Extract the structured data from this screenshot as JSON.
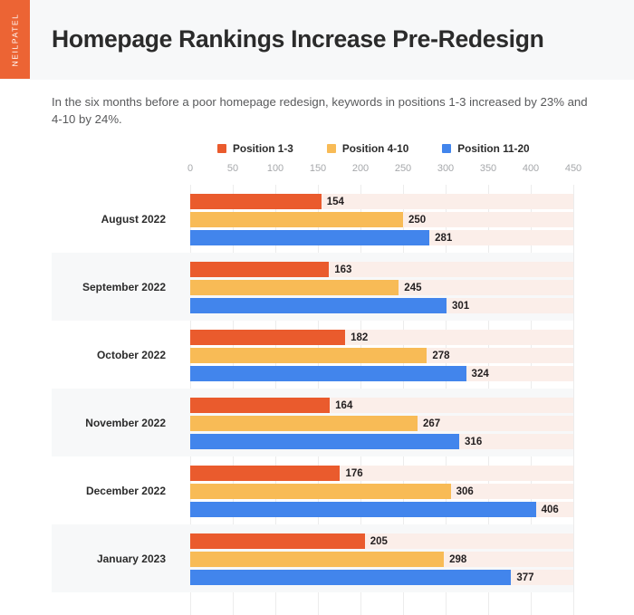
{
  "brand": {
    "name": "NEILPATEL"
  },
  "header": {
    "title": "Homepage Rankings Increase Pre-Redesign"
  },
  "subtitle": {
    "text": "In the six months before a poor homepage redesign, keywords in positions 1-3 increased by 23% and 4-10 by 24%."
  },
  "colors": {
    "position_1_3": "#ea5b2d",
    "position_4_10": "#f8bb56",
    "position_11_20": "#4285ec",
    "track": "#fbeee9",
    "brand_orange": "#ec6434",
    "row_alt": "#f7f8f9",
    "gridline": "#ececec",
    "axis_text": "#a6a8ab"
  },
  "chart_data": {
    "type": "bar",
    "orientation": "horizontal",
    "title": "Homepage Rankings Increase Pre-Redesign",
    "subtitle": "In the six months before a poor homepage redesign, keywords in positions 1-3 increased by 23% and 4-10 by 24%.",
    "xlabel": "",
    "ylabel": "",
    "xlim": [
      0,
      450
    ],
    "xticks": [
      0,
      50,
      100,
      150,
      200,
      250,
      300,
      350,
      400,
      450
    ],
    "grid": true,
    "legend_position": "top",
    "categories": [
      "August 2022",
      "September 2022",
      "October 2022",
      "November 2022",
      "December 2022",
      "January 2023"
    ],
    "series": [
      {
        "name": "Position 1-3",
        "color": "#ea5b2d",
        "values": [
          154,
          163,
          182,
          164,
          176,
          205
        ]
      },
      {
        "name": "Position 4-10",
        "color": "#f8bb56",
        "values": [
          250,
          245,
          278,
          267,
          306,
          298
        ]
      },
      {
        "name": "Position 11-20",
        "color": "#4285ec",
        "values": [
          281,
          301,
          324,
          316,
          406,
          377
        ]
      }
    ]
  }
}
